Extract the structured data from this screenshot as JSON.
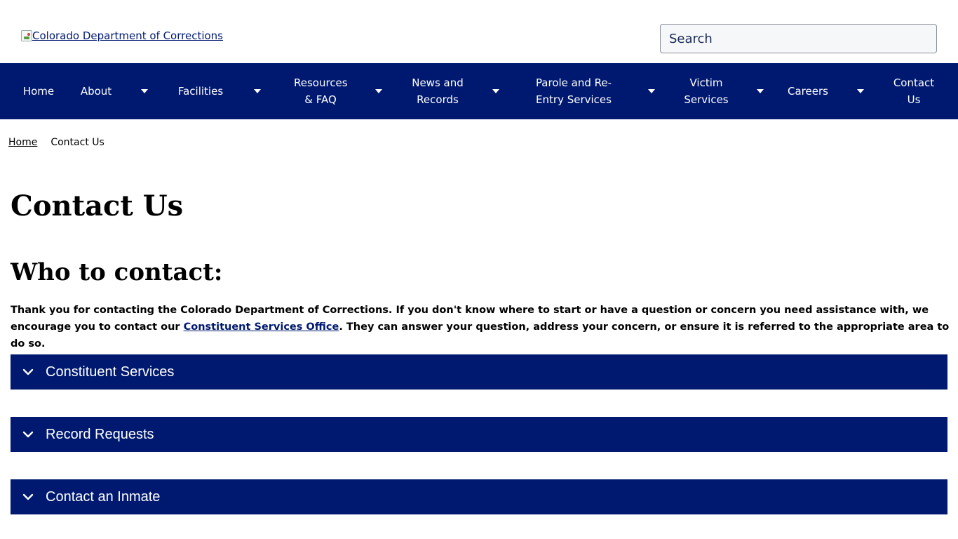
{
  "header": {
    "logo_alt": "Colorado Department of Corrections",
    "search_placeholder": "Search"
  },
  "nav": {
    "items": [
      {
        "label": "Home",
        "has_dropdown": false
      },
      {
        "label": "About",
        "has_dropdown": true
      },
      {
        "label": "Facilities",
        "has_dropdown": true
      },
      {
        "label": "Resources & FAQ",
        "has_dropdown": true
      },
      {
        "label": "News and Records",
        "has_dropdown": true
      },
      {
        "label": "Parole and Re-Entry Services",
        "has_dropdown": true
      },
      {
        "label": "Victim Services",
        "has_dropdown": true
      },
      {
        "label": "Careers",
        "has_dropdown": true
      },
      {
        "label": "Contact Us",
        "has_dropdown": false
      }
    ],
    "icon": "caret-down-icon"
  },
  "breadcrumb": {
    "home": "Home",
    "current": "Contact Us"
  },
  "main": {
    "title": "Contact Us",
    "section_title": "Who to contact:",
    "intro_before": "Thank you for contacting the Colorado Department of Corrections.  If you don't know where to start or have a question or concern you need assistance with, we encourage you to contact our ",
    "intro_link": "Constituent Services Office",
    "intro_after": ".  They can answer your question, address your concern, or ensure it is referred to the appropriate area to do so."
  },
  "accordions": [
    {
      "label": "Constituent Services",
      "icon": "chevron-down-icon"
    },
    {
      "label": "Record Requests",
      "icon": "chevron-down-icon"
    },
    {
      "label": "Contact an Inmate",
      "icon": "chevron-down-icon"
    }
  ],
  "colors": {
    "brand_navy": "#001970",
    "white": "#ffffff"
  }
}
